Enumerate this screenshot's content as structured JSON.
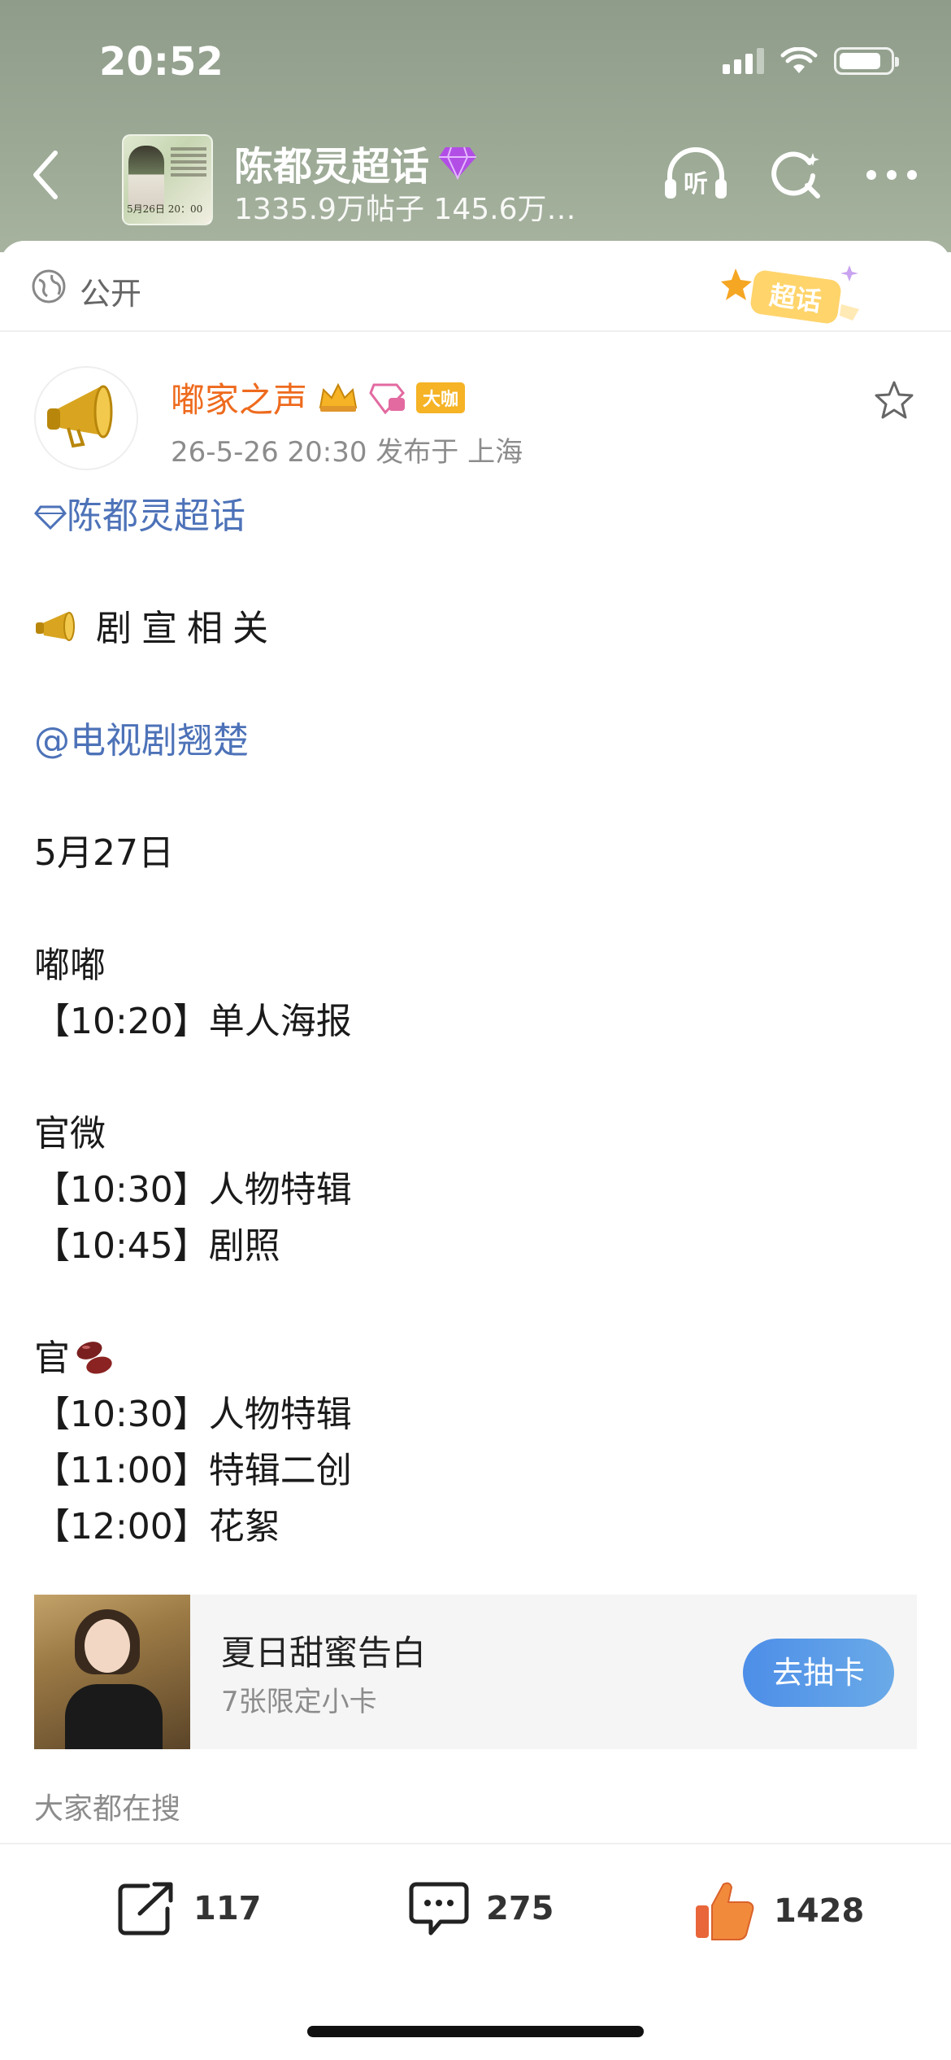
{
  "status_bar": {
    "time": "20:52"
  },
  "header": {
    "topic_title": "陈都灵超话",
    "topic_stats": "1335.9万帖子 145.6万…",
    "thumb_date_text": "5月26日 20：00",
    "icons": [
      "back-icon",
      "listen-icon",
      "search-icon",
      "more-icon"
    ],
    "listen_label": "听"
  },
  "visibility": {
    "label": "公开",
    "sticker_text": "超话"
  },
  "post": {
    "author": "嘟家之声",
    "badge": "大咖",
    "meta": "26-5-26 20:30  发布于 上海",
    "lines": [
      {
        "text": "陈都灵超话",
        "kind": "topic-link"
      },
      {
        "text": "",
        "kind": "blank"
      },
      {
        "text": "剧宣相关",
        "kind": "heading"
      },
      {
        "text": "",
        "kind": "blank"
      },
      {
        "text": "@电视剧翘楚",
        "kind": "mention"
      },
      {
        "text": "",
        "kind": "blank"
      },
      {
        "text": "5月27日",
        "kind": "text"
      },
      {
        "text": "",
        "kind": "blank"
      },
      {
        "text": "嘟嘟",
        "kind": "text"
      },
      {
        "text": "【10:20】单人海报",
        "kind": "text"
      },
      {
        "text": "",
        "kind": "blank"
      },
      {
        "text": "官微",
        "kind": "text"
      },
      {
        "text": "【10:30】人物特辑",
        "kind": "text"
      },
      {
        "text": "【10:45】剧照",
        "kind": "text"
      },
      {
        "text": "",
        "kind": "blank"
      },
      {
        "text": "官",
        "kind": "bean"
      },
      {
        "text": "【10:30】人物特辑",
        "kind": "text"
      },
      {
        "text": "【11:00】特辑二创",
        "kind": "text"
      },
      {
        "text": "【12:00】花絮",
        "kind": "text"
      }
    ]
  },
  "card": {
    "title": "夏日甜蜜告白",
    "subtitle": "7张限定小卡",
    "button": "去抽卡"
  },
  "search_hint": "大家都在搜",
  "actions": {
    "share_count": "117",
    "comment_count": "275",
    "like_count": "1428"
  },
  "colors": {
    "author": "#ee6a1d",
    "link": "#4d72b8",
    "button": "#4d8ee8",
    "like": "#f28a3c"
  }
}
